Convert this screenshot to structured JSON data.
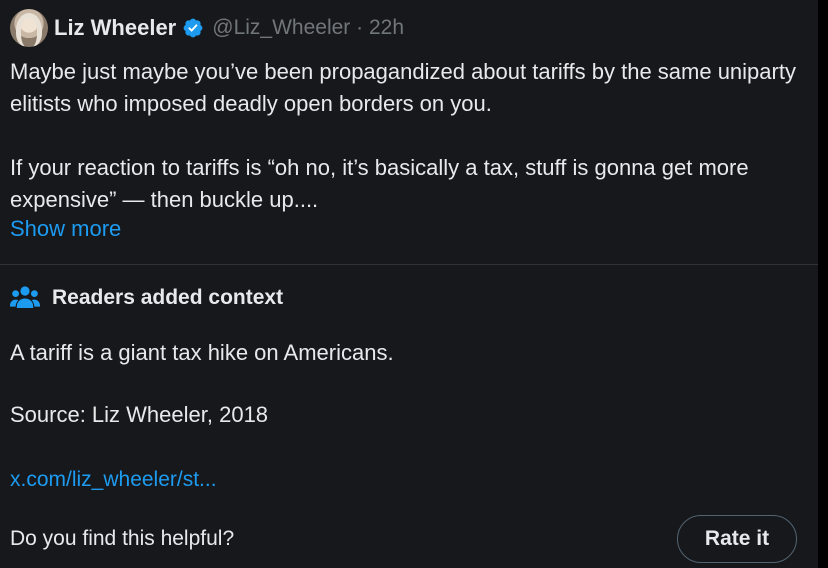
{
  "tweet": {
    "author": {
      "display_name": "Liz Wheeler",
      "handle": "@Liz_Wheeler",
      "time": "22h",
      "separator": "·"
    },
    "text_paragraphs": [
      "Maybe just maybe you’ve been propagandized about tariffs by the same uniparty elitists who imposed deadly open borders on you.",
      "If your reaction to tariffs is “oh no, it’s basically a tax, stuff is gonna get more expensive” — then buckle up...."
    ],
    "show_more_label": "Show more"
  },
  "community_note": {
    "title": "Readers added context",
    "body": "A tariff is a giant tax hike on Americans.",
    "source": "Source: Liz Wheeler, 2018",
    "link": "x.com/liz_wheeler/st...",
    "helpful_question": "Do you find this helpful?",
    "rate_label": "Rate it"
  },
  "colors": {
    "background": "#16181c",
    "text": "#e7e9ea",
    "muted": "#71767b",
    "accent": "#1d9bf0",
    "divider": "#2f3336"
  },
  "icons": {
    "verified": "verified-badge-icon",
    "people": "people-icon"
  }
}
